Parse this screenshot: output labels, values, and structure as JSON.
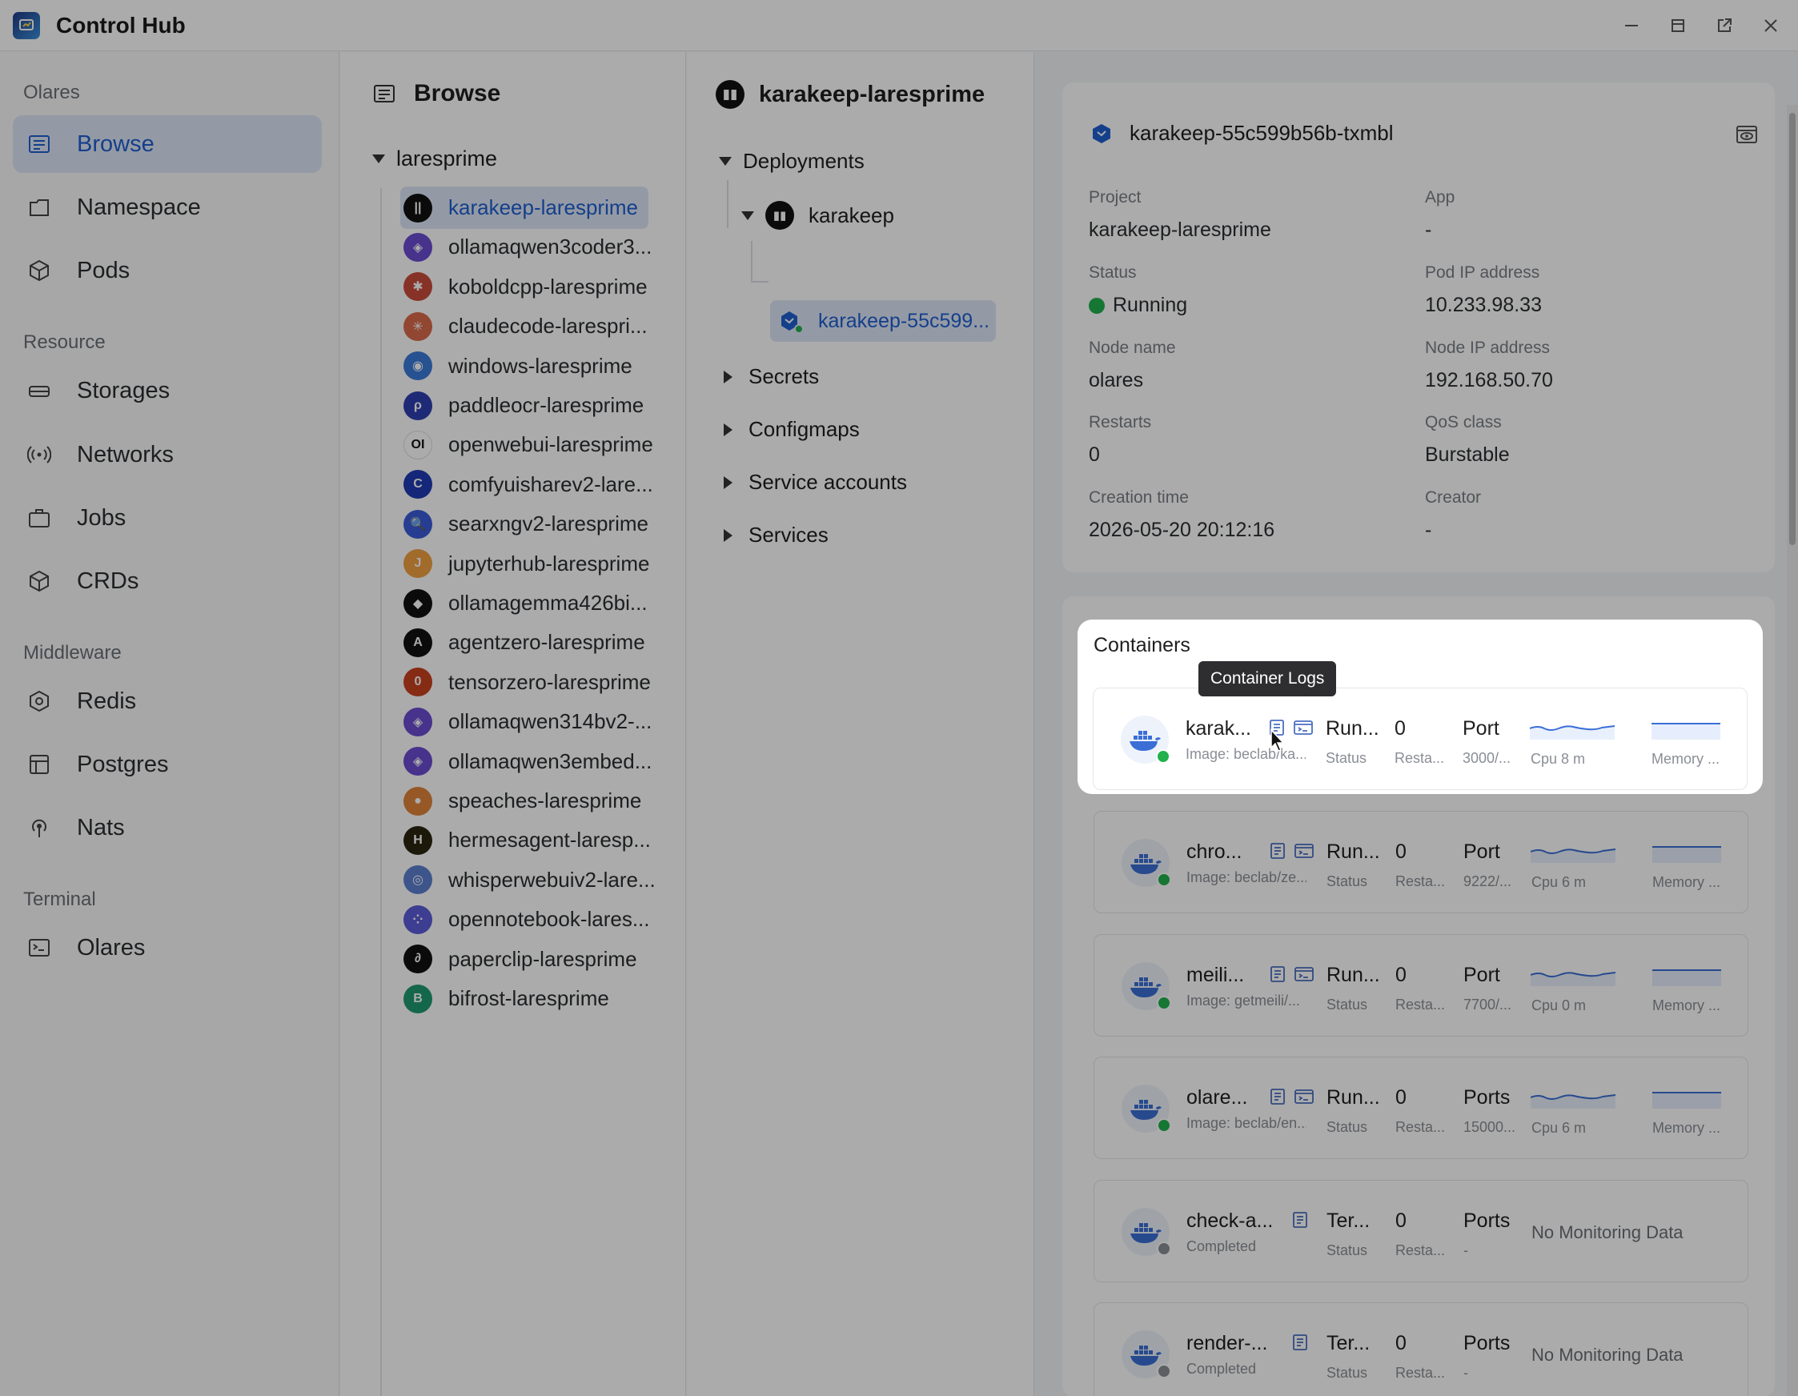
{
  "window": {
    "title": "Control Hub"
  },
  "sidebar": {
    "sections": [
      {
        "label": "Olares"
      },
      {
        "label": "Resource"
      },
      {
        "label": "Middleware"
      },
      {
        "label": "Terminal"
      }
    ],
    "items": [
      {
        "label": "Browse",
        "icon": "browse-icon",
        "active": true
      },
      {
        "label": "Namespace",
        "icon": "namespace-icon"
      },
      {
        "label": "Pods",
        "icon": "pods-icon"
      },
      {
        "label": "Storages",
        "icon": "storages-icon"
      },
      {
        "label": "Networks",
        "icon": "networks-icon"
      },
      {
        "label": "Jobs",
        "icon": "jobs-icon"
      },
      {
        "label": "CRDs",
        "icon": "crds-icon"
      },
      {
        "label": "Redis",
        "icon": "redis-icon"
      },
      {
        "label": "Postgres",
        "icon": "postgres-icon"
      },
      {
        "label": "Nats",
        "icon": "nats-icon"
      },
      {
        "label": "Olares",
        "icon": "terminal-icon"
      }
    ]
  },
  "browse": {
    "title": "Browse",
    "root": "laresprime",
    "apps": [
      {
        "label": "karakeep-laresprime",
        "color": "#111111",
        "glyph": "||",
        "active": true
      },
      {
        "label": "ollamaqwen3coder3...",
        "color": "#6a4bd1",
        "glyph": "◈"
      },
      {
        "label": "koboldcpp-laresprime",
        "color": "#c94b3b",
        "glyph": "✱"
      },
      {
        "label": "claudecode-larespri...",
        "color": "#d86a4a",
        "glyph": "✳"
      },
      {
        "label": "windows-laresprime",
        "color": "#3b7bd9",
        "glyph": "◉"
      },
      {
        "label": "paddleocr-laresprime",
        "color": "#2f3fb0",
        "glyph": "ρ"
      },
      {
        "label": "openwebui-laresprime",
        "color": "#ffffff",
        "glyph": "OI"
      },
      {
        "label": "comfyuisharev2-lare...",
        "color": "#1f3bb3",
        "glyph": "C"
      },
      {
        "label": "searxngv2-laresprime",
        "color": "#3a5bd8",
        "glyph": "🔍"
      },
      {
        "label": "jupyterhub-laresprime",
        "color": "#f0a040",
        "glyph": "J"
      },
      {
        "label": "ollamagemma426bi...",
        "color": "#111111",
        "glyph": "◆"
      },
      {
        "label": "agentzero-laresprime",
        "color": "#111111",
        "glyph": "A"
      },
      {
        "label": "tensorzero-laresprime",
        "color": "#c8401f",
        "glyph": "0"
      },
      {
        "label": "ollamaqwen314bv2-...",
        "color": "#6a4bd1",
        "glyph": "◈"
      },
      {
        "label": "ollamaqwen3embed...",
        "color": "#6a4bd1",
        "glyph": "◈"
      },
      {
        "label": "speaches-laresprime",
        "color": "#e0833a",
        "glyph": "●"
      },
      {
        "label": "hermesagent-laresp...",
        "color": "#2a2410",
        "glyph": "H"
      },
      {
        "label": "whisperwebuiv2-lare...",
        "color": "#5b7fd0",
        "glyph": "◎"
      },
      {
        "label": "opennotebook-lares...",
        "color": "#5b5bd8",
        "glyph": "⁘"
      },
      {
        "label": "paperclip-laresprime",
        "color": "#111111",
        "glyph": "∂"
      },
      {
        "label": "bifrost-laresprime",
        "color": "#1f9a70",
        "glyph": "B"
      }
    ]
  },
  "namespace": {
    "title": "karakeep-laresprime",
    "deployments": "Deployments",
    "deployment": "karakeep",
    "pod": "karakeep-55c599...",
    "groups": [
      "Secrets",
      "Configmaps",
      "Service accounts",
      "Services"
    ]
  },
  "pod": {
    "name": "karakeep-55c599b56b-txmbl",
    "fields": [
      {
        "key": "Project",
        "value": "karakeep-laresprime"
      },
      {
        "key": "App",
        "value": "-"
      },
      {
        "key": "Status",
        "value": "Running"
      },
      {
        "key": "Pod IP address",
        "value": "10.233.98.33"
      },
      {
        "key": "Node name",
        "value": "olares"
      },
      {
        "key": "Node IP address",
        "value": "192.168.50.70"
      },
      {
        "key": "Restarts",
        "value": "0"
      },
      {
        "key": "QoS class",
        "value": "Burstable"
      },
      {
        "key": "Creation time",
        "value": "2026-05-20 20:12:16"
      },
      {
        "key": "Creator",
        "value": "-"
      }
    ]
  },
  "containers": {
    "title": "Containers",
    "tooltip": "Container Logs",
    "status_label": "Status",
    "restarts_label": "Resta...",
    "memory_label": "Memory ...",
    "no_monitoring": "No Monitoring Data",
    "items": [
      {
        "name": "karak...",
        "image": "Image: beclab/ka...",
        "status": "Run...",
        "restarts": "0",
        "port_label": "Port",
        "port": "3000/...",
        "cpu": "Cpu 8 m",
        "state": "running",
        "terminal": true
      },
      {
        "name": "chro...",
        "image": "Image: beclab/ze...",
        "status": "Run...",
        "restarts": "0",
        "port_label": "Port",
        "port": "9222/...",
        "cpu": "Cpu 6 m",
        "state": "running",
        "terminal": true
      },
      {
        "name": "meili...",
        "image": "Image: getmeili/...",
        "status": "Run...",
        "restarts": "0",
        "port_label": "Port",
        "port": "7700/...",
        "cpu": "Cpu 0 m",
        "state": "running",
        "terminal": true
      },
      {
        "name": "olare...",
        "image": "Image: beclab/en...",
        "status": "Run...",
        "restarts": "0",
        "port_label": "Ports",
        "port": "15000...",
        "cpu": "Cpu 6 m",
        "state": "running",
        "terminal": true
      },
      {
        "name": "check-a...",
        "image": "Completed",
        "status": "Ter...",
        "restarts": "0",
        "port_label": "Ports",
        "port": "-",
        "state": "completed",
        "terminal": false
      },
      {
        "name": "render-...",
        "image": "Completed",
        "status": "Ter...",
        "restarts": "0",
        "port_label": "Ports",
        "port": "-",
        "state": "completed",
        "terminal": false
      }
    ]
  },
  "colors": {
    "accent": "#1f5fd0",
    "running": "#22b14c",
    "completed": "#8a8e94",
    "selected_bg": "#dde6f7"
  }
}
